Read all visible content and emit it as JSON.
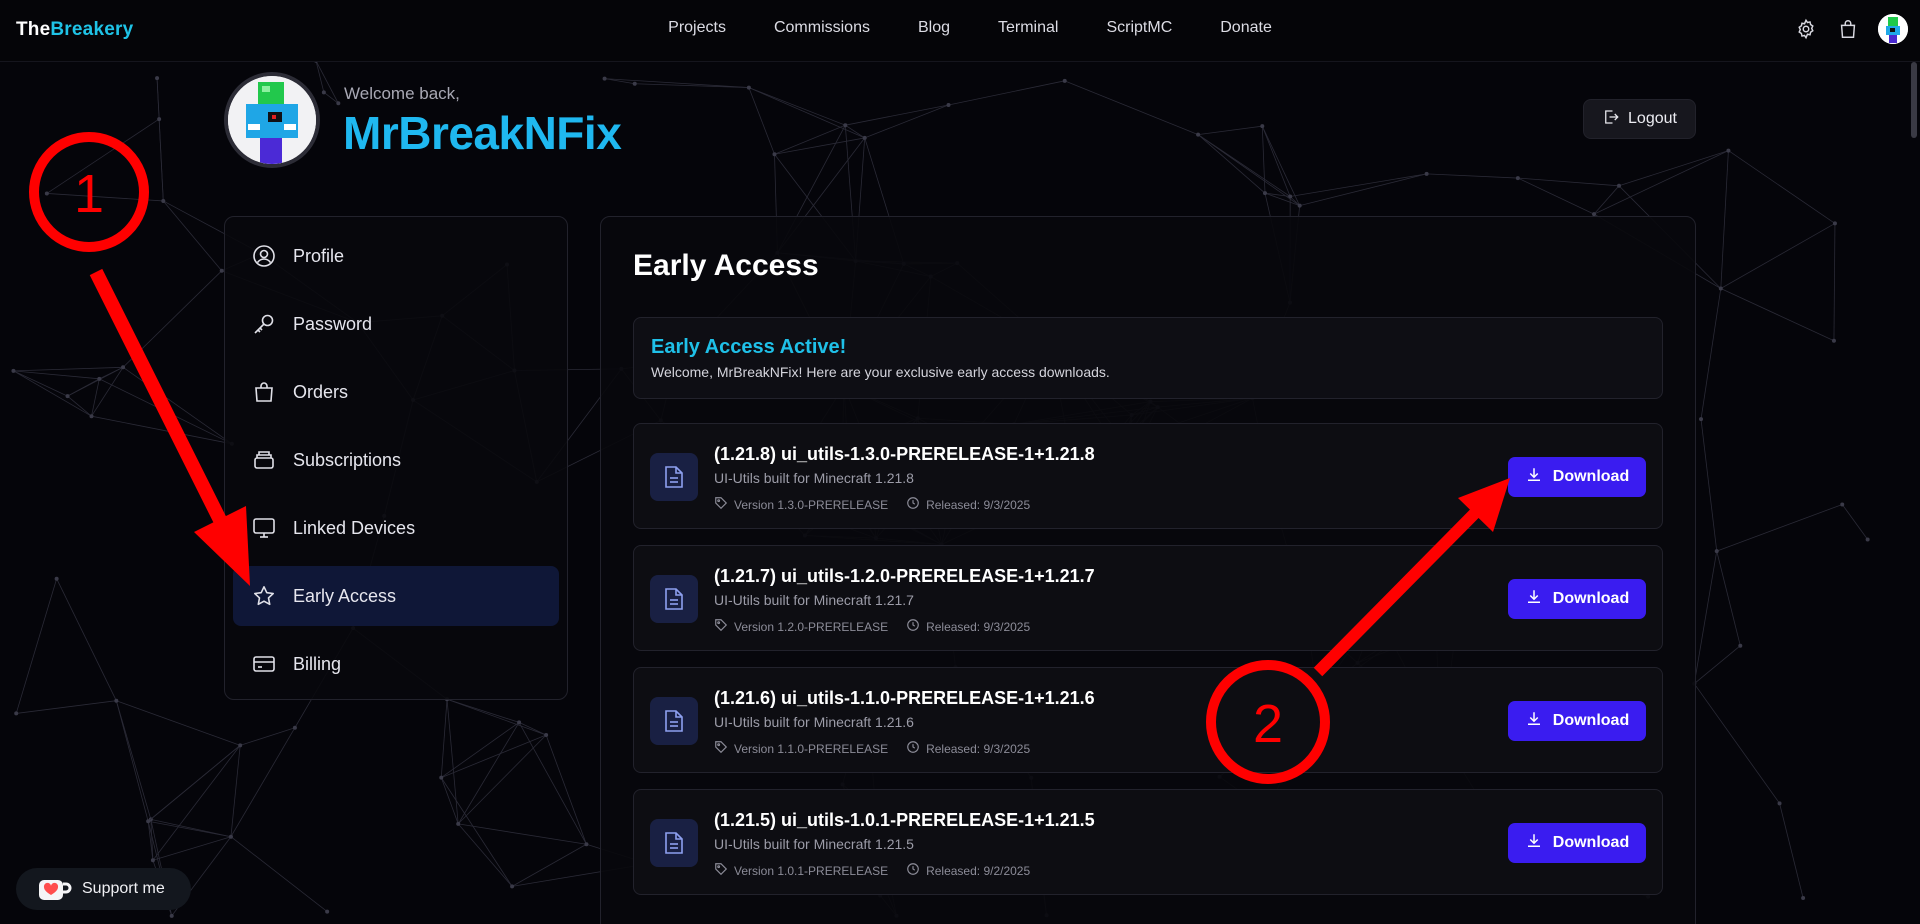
{
  "nav": {
    "brand_a": "The",
    "brand_b": "Breakery",
    "links": [
      "Projects",
      "Commissions",
      "Blog",
      "Terminal",
      "ScriptMC",
      "Donate"
    ],
    "icons": [
      "gear-icon",
      "shopping-bag-icon",
      "user-avatar"
    ]
  },
  "header": {
    "welcome": "Welcome back,",
    "username": "MrBreakNFix",
    "logout_label": "Logout"
  },
  "sidebar": {
    "items": [
      {
        "label": "Profile",
        "icon": "user-circle-icon"
      },
      {
        "label": "Password",
        "icon": "key-icon"
      },
      {
        "label": "Orders",
        "icon": "shopping-bag-icon"
      },
      {
        "label": "Subscriptions",
        "icon": "stack-icon"
      },
      {
        "label": "Linked Devices",
        "icon": "monitor-icon"
      },
      {
        "label": "Early Access",
        "icon": "star-icon",
        "active": true
      },
      {
        "label": "Billing",
        "icon": "credit-card-icon"
      }
    ]
  },
  "main": {
    "title": "Early Access",
    "notice_title": "Early Access Active!",
    "notice_text": "Welcome, MrBreakNFix! Here are your exclusive early access downloads.",
    "download_label": "Download",
    "files": [
      {
        "title": "(1.21.8) ui_utils-1.3.0-PRERELEASE-1+1.21.8",
        "subtitle": "UI-Utils built for Minecraft 1.21.8",
        "version": "Version 1.3.0-PRERELEASE",
        "released": "Released: 9/3/2025"
      },
      {
        "title": "(1.21.7) ui_utils-1.2.0-PRERELEASE-1+1.21.7",
        "subtitle": "UI-Utils built for Minecraft 1.21.7",
        "version": "Version 1.2.0-PRERELEASE",
        "released": "Released: 9/3/2025"
      },
      {
        "title": "(1.21.6) ui_utils-1.1.0-PRERELEASE-1+1.21.6",
        "subtitle": "UI-Utils built for Minecraft 1.21.6",
        "version": "Version 1.1.0-PRERELEASE",
        "released": "Released: 9/3/2025"
      },
      {
        "title": "(1.21.5) ui_utils-1.0.1-PRERELEASE-1+1.21.5",
        "subtitle": "UI-Utils built for Minecraft 1.21.5",
        "version": "Version 1.0.1-PRERELEASE",
        "released": "Released: 9/2/2025"
      }
    ]
  },
  "support": {
    "label": "Support me"
  },
  "annotations": {
    "marker_1": "1",
    "marker_2": "2",
    "color": "#ff0000"
  },
  "colors": {
    "accent_cyan": "#1fc3e6",
    "download_button": "#3a1cf0",
    "active_item": "#0f1737"
  }
}
